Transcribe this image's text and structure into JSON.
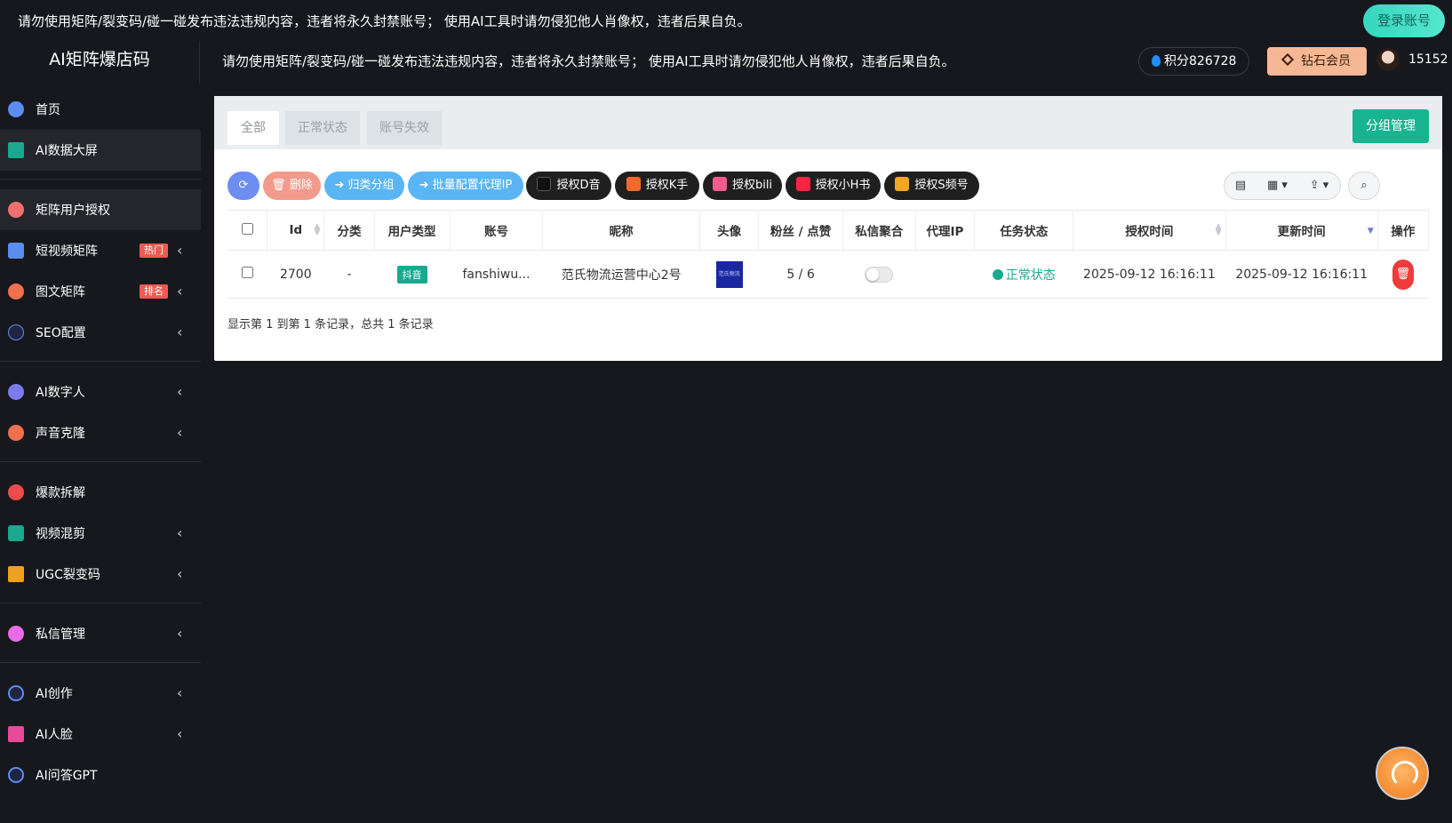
{
  "notice": "请勿使用矩阵/裂变码/碰一碰发布违法违规内容，违者将永久封禁账号； 使用AI工具时请勿侵犯他人肖像权，违者后果自负。",
  "login_label": "登录账号",
  "logo": "AI矩阵爆店码",
  "points_label": "积分826728",
  "vip_label": "钻石会员",
  "user_id": "15152",
  "sidebar": [
    {
      "label": "首页",
      "icon": "pie-chart-icon",
      "color": "#5b8def"
    },
    {
      "label": "AI数据大屏",
      "icon": "chart-screen-icon",
      "color": "#1aa890",
      "active": true
    },
    {
      "label": "矩阵用户授权",
      "icon": "users-icon",
      "color": "#f07070",
      "active": true
    },
    {
      "label": "短视频矩阵",
      "icon": "video-matrix-icon",
      "color": "#5b8def",
      "badge": "热门",
      "chev": true
    },
    {
      "label": "图文矩阵",
      "icon": "image-text-icon",
      "color": "#f07050",
      "badge": "排名",
      "chev": true
    },
    {
      "label": "SEO配置",
      "icon": "seo-icon",
      "color": "#5b8def",
      "chev": true
    },
    {
      "label": "AI数字人",
      "icon": "digital-human-icon",
      "color": "#7b7bef",
      "chev": true
    },
    {
      "label": "声音克隆",
      "icon": "voice-icon",
      "color": "#f07050",
      "chev": true
    },
    {
      "label": "爆款拆解",
      "icon": "hot-icon",
      "color": "#ef4b4b"
    },
    {
      "label": "视频混剪",
      "icon": "clip-icon",
      "color": "#1aa890",
      "chev": true
    },
    {
      "label": "UGC裂变码",
      "icon": "qr-code-icon",
      "color": "#f0a020",
      "chev": true
    },
    {
      "label": "私信管理",
      "icon": "message-icon",
      "color": "#e86be8",
      "chev": true
    },
    {
      "label": "AI创作",
      "icon": "ai-create-icon",
      "color": "#5b8def",
      "chev": true
    },
    {
      "label": "AI人脸",
      "icon": "face-icon",
      "color": "#e84a9a",
      "chev": true
    },
    {
      "label": "AI问答GPT",
      "icon": "gpt-icon",
      "color": "#5b8def"
    }
  ],
  "tabs": [
    "全部",
    "正常状态",
    "账号失效"
  ],
  "group_manage": "分组管理",
  "toolbar": {
    "refresh": "⟳",
    "delete": "删除",
    "classify": "归类分组",
    "proxy": "批量配置代理IP",
    "douyin": "授权D音",
    "kuaishou": "授权K手",
    "bili": "授权bili",
    "xhs": "授权小H书",
    "video": "授权S频号",
    "colors": {
      "refresh": "#6d8ef0",
      "delete": "#f29a8c",
      "blue": "#5ab5f4",
      "dark": "#1f1f1f"
    }
  },
  "columns": [
    "Id",
    "分类",
    "用户类型",
    "账号",
    "昵称",
    "头像",
    "粉丝 / 点赞",
    "私信聚合",
    "代理IP",
    "任务状态",
    "授权时间",
    "更新时间",
    "操作"
  ],
  "rows": [
    {
      "id": "2700",
      "category": "-",
      "user_type": "抖音",
      "account": "fanshiwu...",
      "nickname": "范氏物流运营中心2号",
      "avatar_text": "范氏物流",
      "fans_likes": "5 / 6",
      "proxy": "",
      "status": "正常状态",
      "auth_time": "2025-09-12 16:16:11",
      "update_time": "2025-09-12 16:16:11"
    }
  ],
  "records": "显示第 1 到第 1 条记录，总共 1 条记录"
}
